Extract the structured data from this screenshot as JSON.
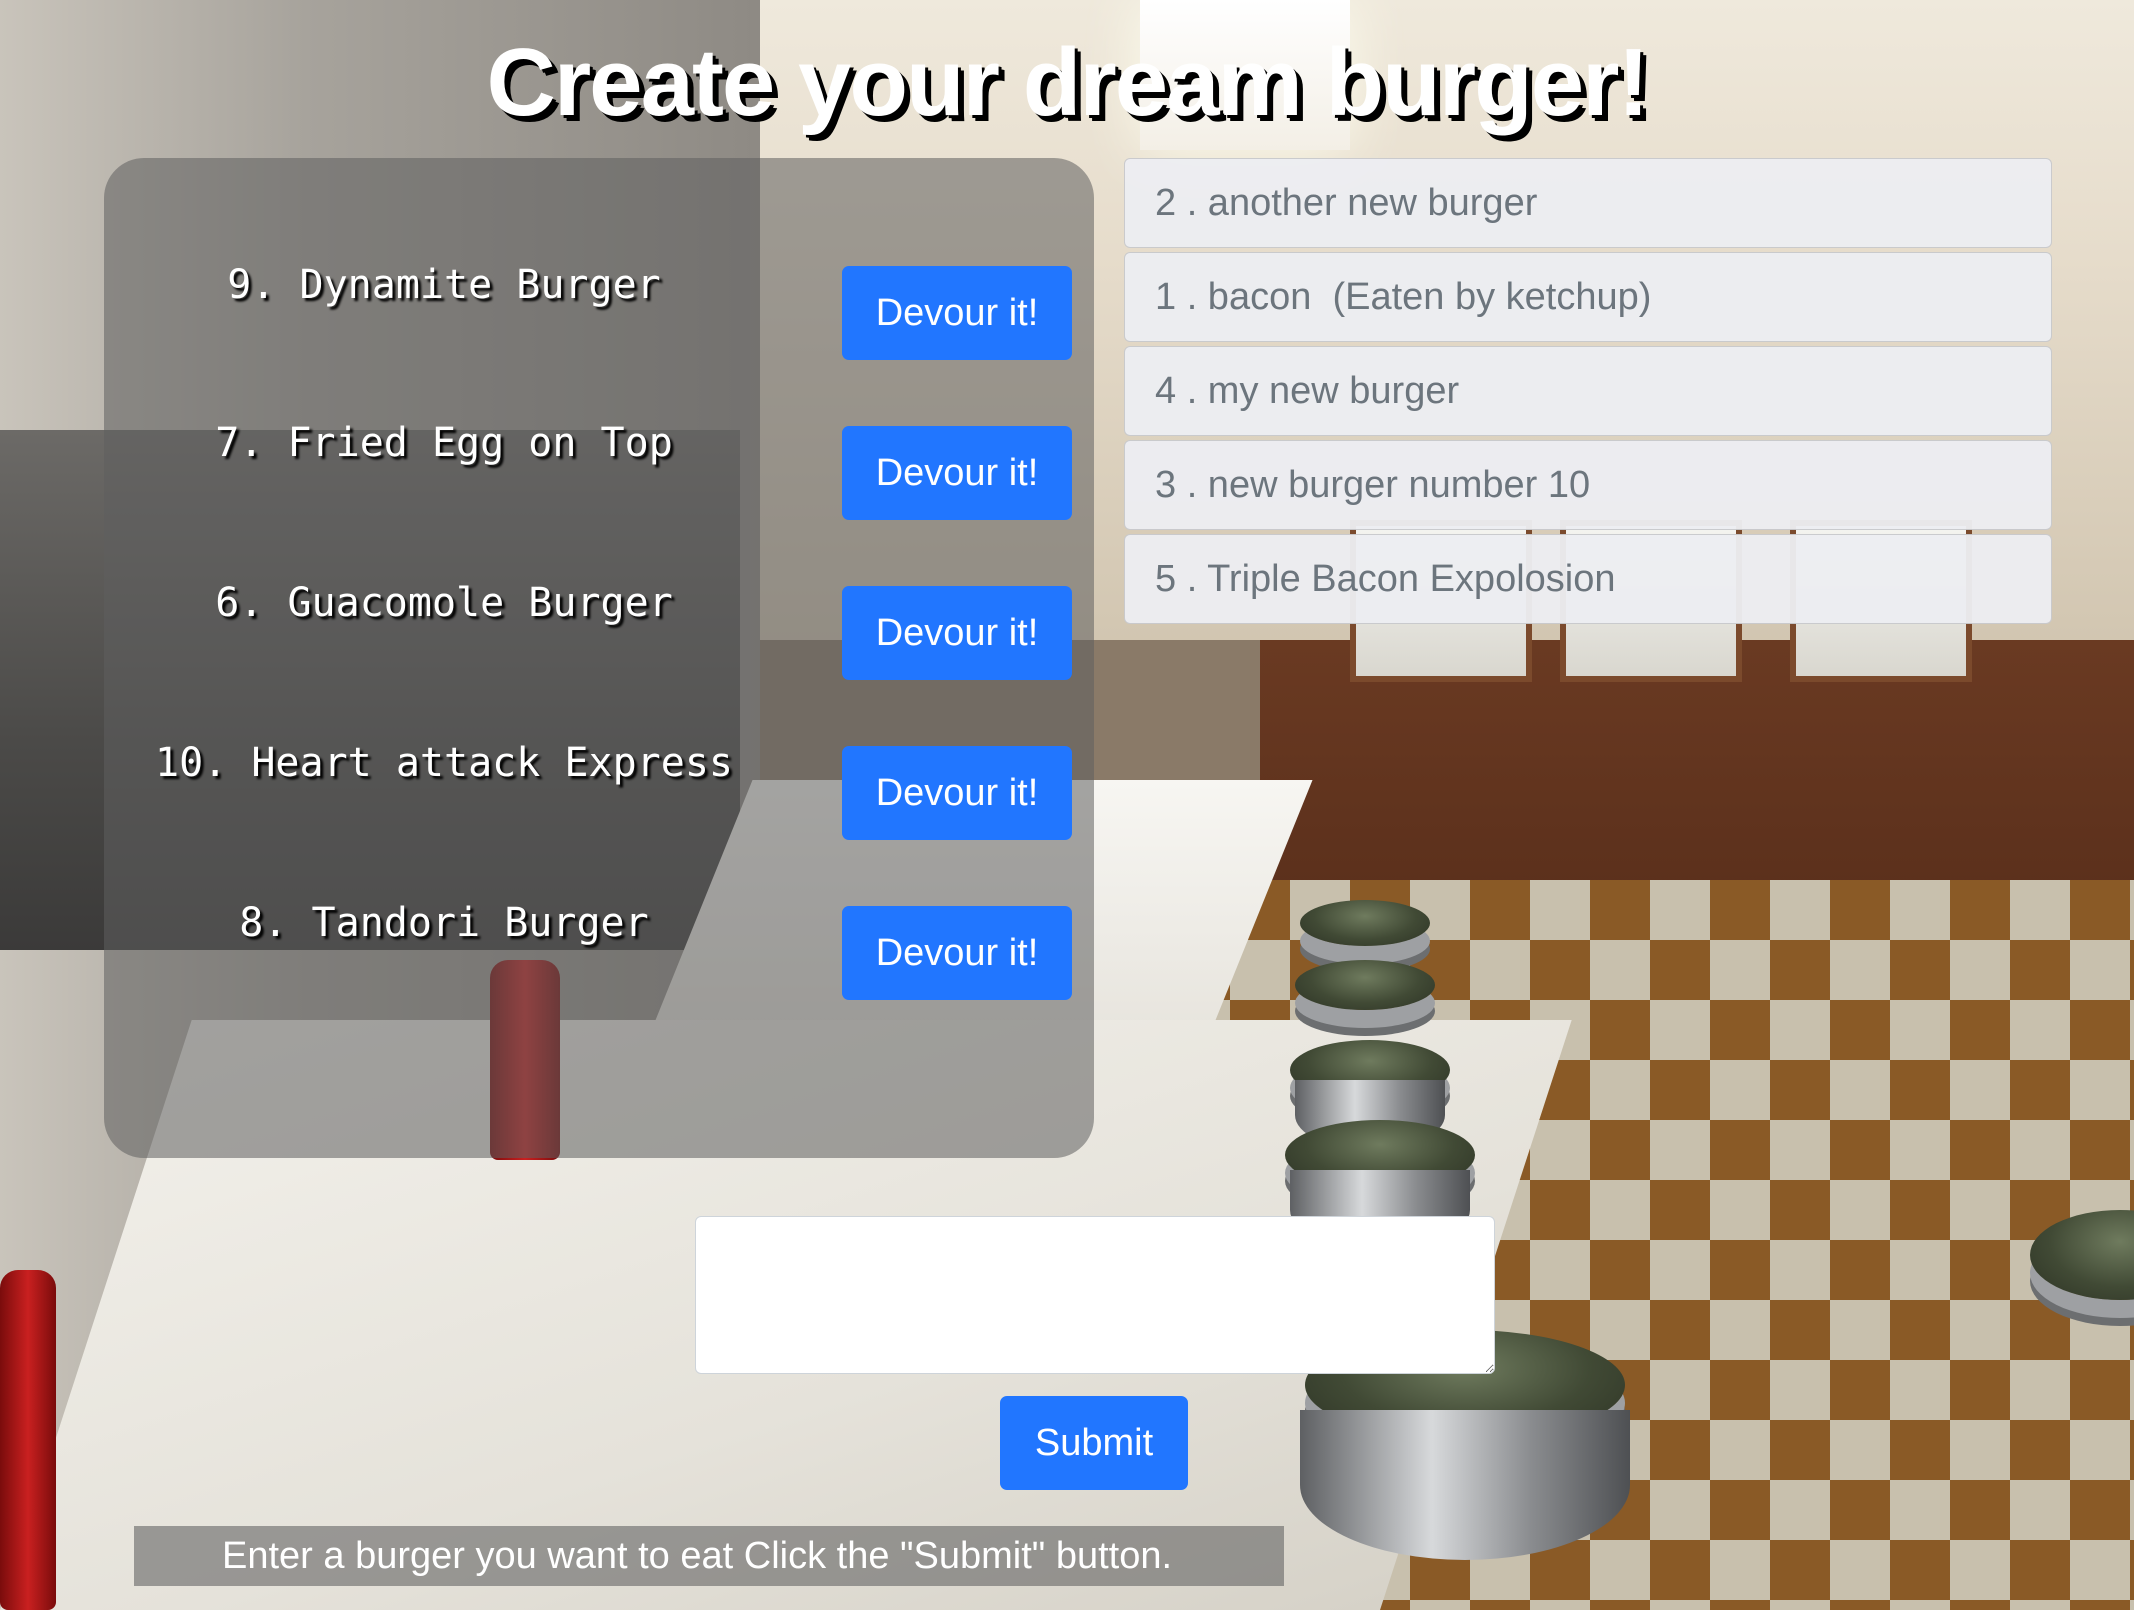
{
  "page": {
    "title": "Create your dream burger!"
  },
  "uneaten_burgers": [
    {
      "label": "9. Dynamite Burger",
      "button": "Devour it!"
    },
    {
      "label": "7. Fried Egg on Top",
      "button": "Devour it!"
    },
    {
      "label": "6. Guacomole Burger",
      "button": "Devour it!"
    },
    {
      "label": "10. Heart attack Express",
      "button": "Devour it!"
    },
    {
      "label": "8. Tandori Burger",
      "button": "Devour it!"
    }
  ],
  "eaten_burgers": [
    {
      "label": "2 . another new burger"
    },
    {
      "label": "1 . bacon  (Eaten by ketchup)"
    },
    {
      "label": "4 . my new burger"
    },
    {
      "label": "3 . new burger number 10"
    },
    {
      "label": "5 . Triple Bacon Expolosion"
    }
  ],
  "form": {
    "input_value": "",
    "submit_label": "Submit",
    "instructions": "Enter a burger you want to eat Click the \"Submit\" button."
  },
  "colors": {
    "button_blue": "#2176ff",
    "title_white": "#ffffff",
    "list_text_gray": "#6c757d"
  }
}
